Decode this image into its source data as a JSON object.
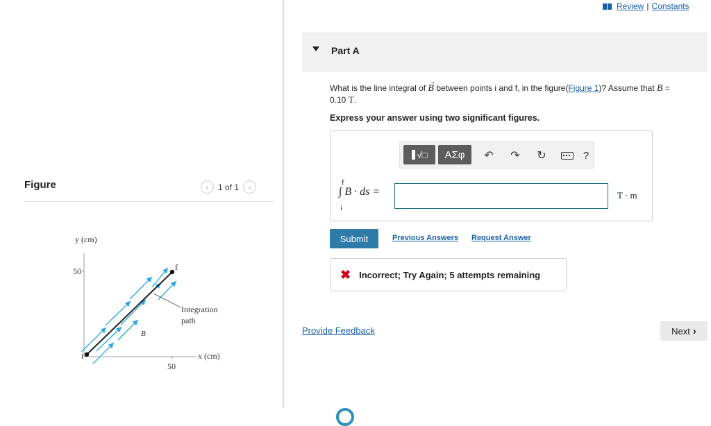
{
  "figure_panel": {
    "title": "Figure",
    "nav_text": "1 of 1",
    "prev_icon": "chevron-left-icon",
    "next_icon": "chevron-right-icon",
    "diagram": {
      "y_axis_label": "y (cm)",
      "x_axis_label": "x (cm)",
      "y_tick": "50",
      "x_tick": "50",
      "start_point_label": "i",
      "end_point_label": "f",
      "field_label": "B",
      "path_label_line1": "Integration",
      "path_label_line2": "path",
      "field_arrow_color": "#29a9e0",
      "path_color": "#222222"
    }
  },
  "top_links": {
    "book_icon": "book-icon",
    "review": "Review",
    "separator": "|",
    "constants": "Constants"
  },
  "part": {
    "caret_icon": "caret-down-icon",
    "title": "Part A",
    "question_pre": "What is the line integral of",
    "question_vec": "B",
    "question_mid": "between points i and f, in the figure(",
    "question_link": "Figure 1",
    "question_post": ")? Assume that",
    "question_b": "B",
    "question_eq": "=",
    "question_value": "0.10",
    "question_unit": "T",
    "question_end": ".",
    "instructions": "Express your answer using two significant figures."
  },
  "answer": {
    "toolbar": {
      "template_icon": "fraction-sqrt-template-icon",
      "greek_label": "ΑΣφ",
      "undo_icon": "undo-icon",
      "redo_icon": "redo-icon",
      "reset_icon": "reset-icon",
      "keyboard_icon": "keyboard-icon",
      "help_label": "?"
    },
    "integral_upper": "f",
    "integral_lower": "i",
    "integral_expr": "∫ B · ds =",
    "input_value": "",
    "unit": "T · m"
  },
  "actions": {
    "submit": "Submit",
    "previous_answers": "Previous Answers",
    "request_answer": "Request Answer"
  },
  "feedback": {
    "status_icon": "x-mark-icon",
    "status_color": "#d0021b",
    "message": "Incorrect; Try Again; 5 attempts remaining"
  },
  "footer": {
    "provide_feedback": "Provide Feedback",
    "next": "Next",
    "next_icon": "chevron-right-icon"
  },
  "colors": {
    "link": "#1a5fa8",
    "submit_bg": "#2e7aa8",
    "input_border": "#1f6b88"
  }
}
